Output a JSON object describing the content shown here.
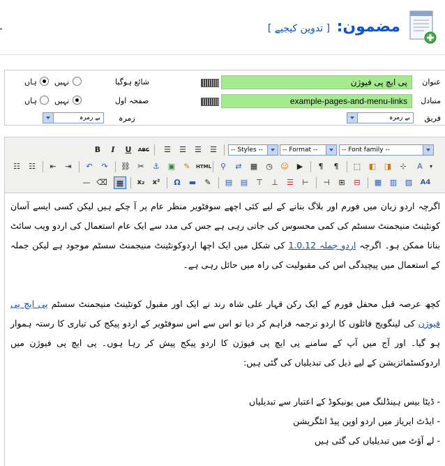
{
  "header": {
    "title": "مضمون:",
    "subtitle": "[ تدوین کیجیے ]",
    "icon": "article-add-icon"
  },
  "details": {
    "title_label": "عنوان",
    "title_value": "پی ایچ پی فیوژن",
    "alias_label": "متبادل",
    "alias_value": "example-pages-and-menu-links",
    "category_label": "فریق",
    "category_value": "بے زمرہ",
    "published_label": "شائع ہوگیا",
    "frontpage_label": "صفحہ اول",
    "section_label": "زمرہ",
    "section_value": "بے زمرہ",
    "no_label": "نہیں",
    "yes_label": "ہاں",
    "published": "yes",
    "frontpage": "yes"
  },
  "toolbar": {
    "styles": "-- Styles --",
    "format": "-- Format --",
    "font_family": "-- Font family --"
  },
  "content": {
    "p1_a": "اگرچہ اردو زبان میں فورم اور بلاگ بنانے کے لیے کئی اچھے سوفٹویر منظر عام پر آ چکے ہیں لیکن کسی ایسے آسان کونٹینٹ منیجمنٹ سسٹم کی کمی محسوس کی جاتی رہی ہے جس کی مدد سے ایک عام استعمال کی اردو ویب سائٹ بنانا ممکن ہو۔ اگرچہ",
    "p1_link": "اردو جملہ 1.0.12",
    "p1_b": "کی شکل میں ایک اچھا اردوکونٹینٹ منیجمنٹ سسٹم موجود ہے لیکن جملہ کے استعمال میں پیچیدگی اس کی مقبولیت کی راہ میں حائل رہی ہے۔",
    "p2_a": "کچھ عرصہ قبل محفل فورم کے ایک رکن قہار علی شاہ رند نے ایک اور مقبول کونٹینٹ منیجمنٹ سسٹم",
    "p2_link": "پی ایچ پی فیوژن",
    "p2_b": "کی لینگویج فائلوں کا اردو ترجمہ فراہم کر دیا تو اس سے اس سوفٹویر کے اردو پیکج کی تیاری کا رستہ ہموار ہو گیا۔ اور آج میں آپ کے سامنے پی ایچ پی فیوژن کا اردو پیکج پیش کر رہا ہوں۔ پی ایچ پی فیوژن میں اردوکسٹمائزیشن کے لیے ذیل کی تبدیلیاں کی گئی ہیں:",
    "li1": "- ڈیٹا بیس ہینڈلنگ میں یونیکوڈ کے اعتبار سے تبدیلیاں",
    "li2": "- ایڈٹ ایریاز میں اردو اوپن پیڈ انٹگریشن",
    "li3": "- لے آؤٹ میں تبدیلیاں کی گئی ہیں"
  },
  "colors": {
    "title_blue": "#0b55c4",
    "input_green": "#a6ea8f",
    "toolbar_bg": "#f0f0ee"
  }
}
